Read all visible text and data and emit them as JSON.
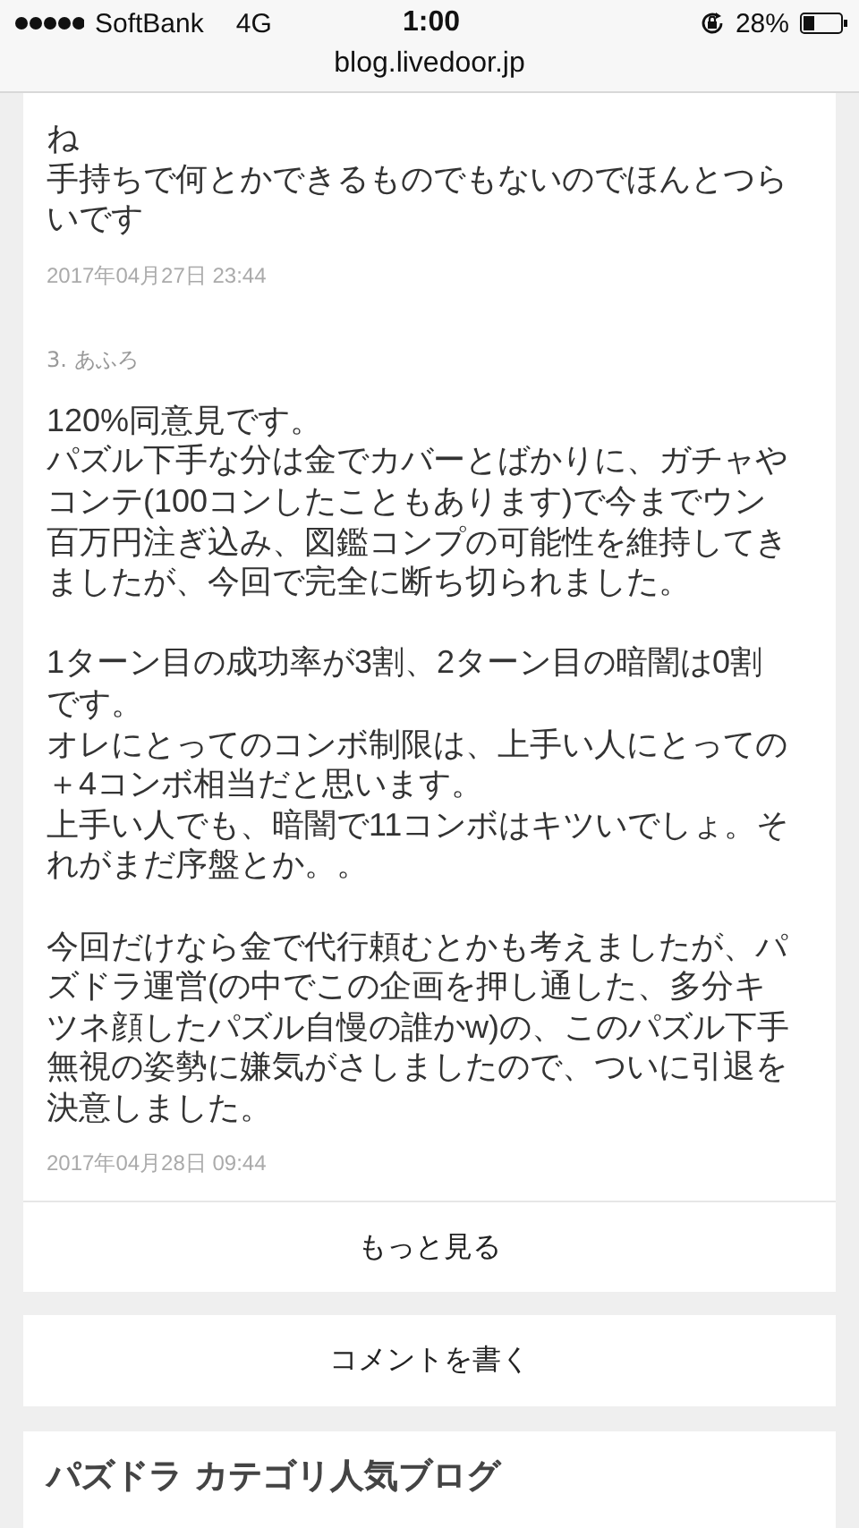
{
  "status_bar": {
    "carrier": "SoftBank",
    "network": "4G",
    "time": "1:00",
    "battery": "28%"
  },
  "address_bar": {
    "url": "blog.livedoor.jp"
  },
  "comments": [
    {
      "paragraphs": [
        [
          "ね",
          "手持ちで何とかできるものでもないのでほんとつらいです"
        ]
      ],
      "date": "2017年04月27日 23:44"
    },
    {
      "header": "3. あふろ",
      "paragraphs": [
        [
          "120%同意見です。",
          "パズル下手な分は金でカバーとばかりに、ガチャやコンテ(100コンしたこともあります)で今までウン百万円注ぎ込み、図鑑コンプの可能性を維持してきましたが、今回で完全に断ち切られました。"
        ],
        [
          "1ターン目の成功率が3割、2ターン目の暗闇は0割です。",
          "オレにとってのコンボ制限は、上手い人にとっての＋4コンボ相当だと思います。",
          "上手い人でも、暗闇で11コンボはキツいでしょ。それがまだ序盤とか。。"
        ],
        [
          "今回だけなら金で代行頼むとかも考えましたが、パズドラ運営(の中でこの企画を押し通した、多分キツネ顔したパズル自慢の誰かw)の、このパズル下手無視の姿勢に嫌気がさしましたので、ついに引退を決意しました。"
        ]
      ],
      "date": "2017年04月28日 09:44"
    }
  ],
  "more_button": "もっと見る",
  "write_button": "コメントを書く",
  "section_title": "パズドラ カテゴリ人気ブログ"
}
